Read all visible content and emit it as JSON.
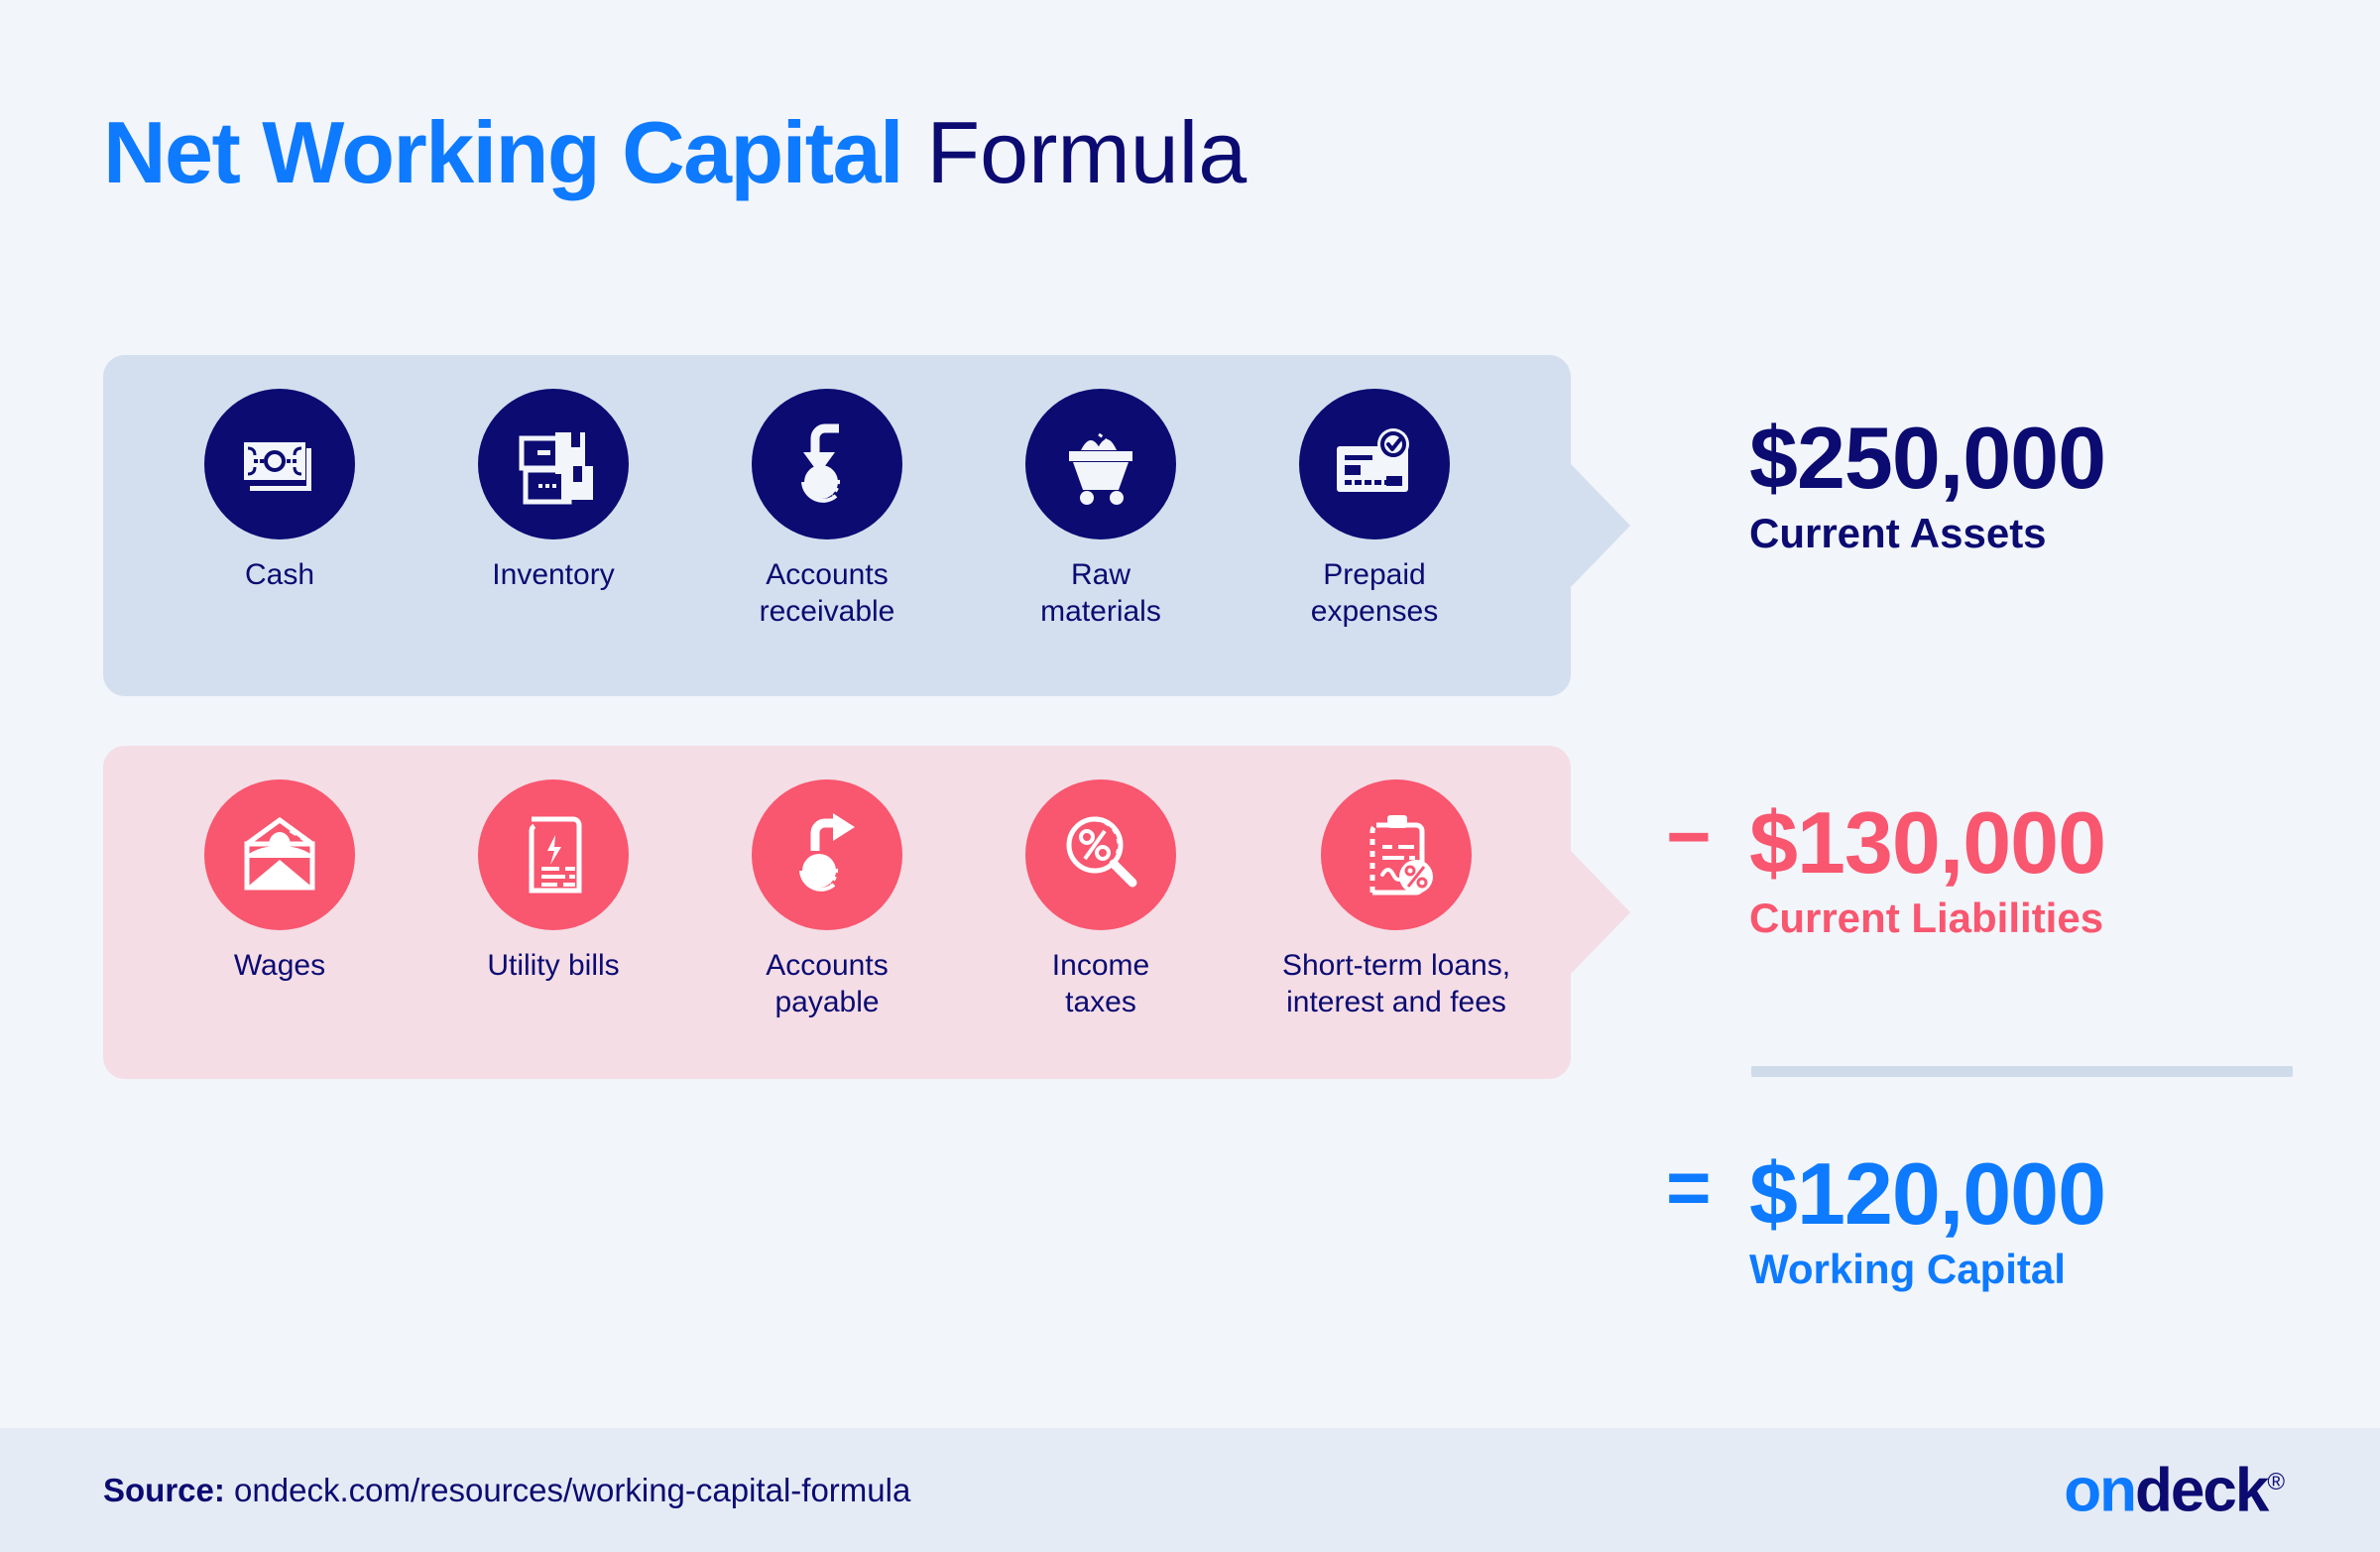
{
  "title": {
    "accent": "Net Working Capital",
    "light": " Formula"
  },
  "colors": {
    "bright_blue": "#0d7aff",
    "navy": "#0b0b72",
    "rose": "#f9566f",
    "panel_assets_bg": "#d3dfee",
    "panel_liabilities_bg": "#f4dde5",
    "page_bg": "#f2f5fa",
    "footer_bg": "#e5ebf4",
    "divider": "#cfdbe9"
  },
  "assets_panel": {
    "items": [
      {
        "label": "Cash",
        "icon": "banknote-icon"
      },
      {
        "label": "Inventory",
        "icon": "boxes-icon"
      },
      {
        "label": "Accounts\nreceivable",
        "icon": "arrow-into-coin-icon"
      },
      {
        "label": "Raw\nmaterials",
        "icon": "mine-cart-icon"
      },
      {
        "label": "Prepaid\nexpenses",
        "icon": "card-check-icon"
      }
    ]
  },
  "liabilities_panel": {
    "items": [
      {
        "label": "Wages",
        "icon": "envelope-person-icon"
      },
      {
        "label": "Utility bills",
        "icon": "invoice-bolt-icon"
      },
      {
        "label": "Accounts\npayable",
        "icon": "arrow-out-coin-icon"
      },
      {
        "label": "Income\ntaxes",
        "icon": "magnifier-percent-icon"
      },
      {
        "label": "Short-term loans,\ninterest and fees",
        "icon": "clipboard-percent-icon"
      }
    ]
  },
  "results": {
    "assets": {
      "operator": "",
      "amount": "$250,000",
      "caption": "Current Assets"
    },
    "liabilities": {
      "operator": "−",
      "amount": "$130,000",
      "caption": "Current Liabilities"
    },
    "working_capital": {
      "operator": "=",
      "amount": "$120,000",
      "caption": "Working Capital"
    }
  },
  "footer": {
    "source_label": "Source:",
    "source_url": " ondeck.com/resources/working-capital-formula",
    "logo_on": "on",
    "logo_deck": "deck",
    "logo_registered": "®"
  }
}
